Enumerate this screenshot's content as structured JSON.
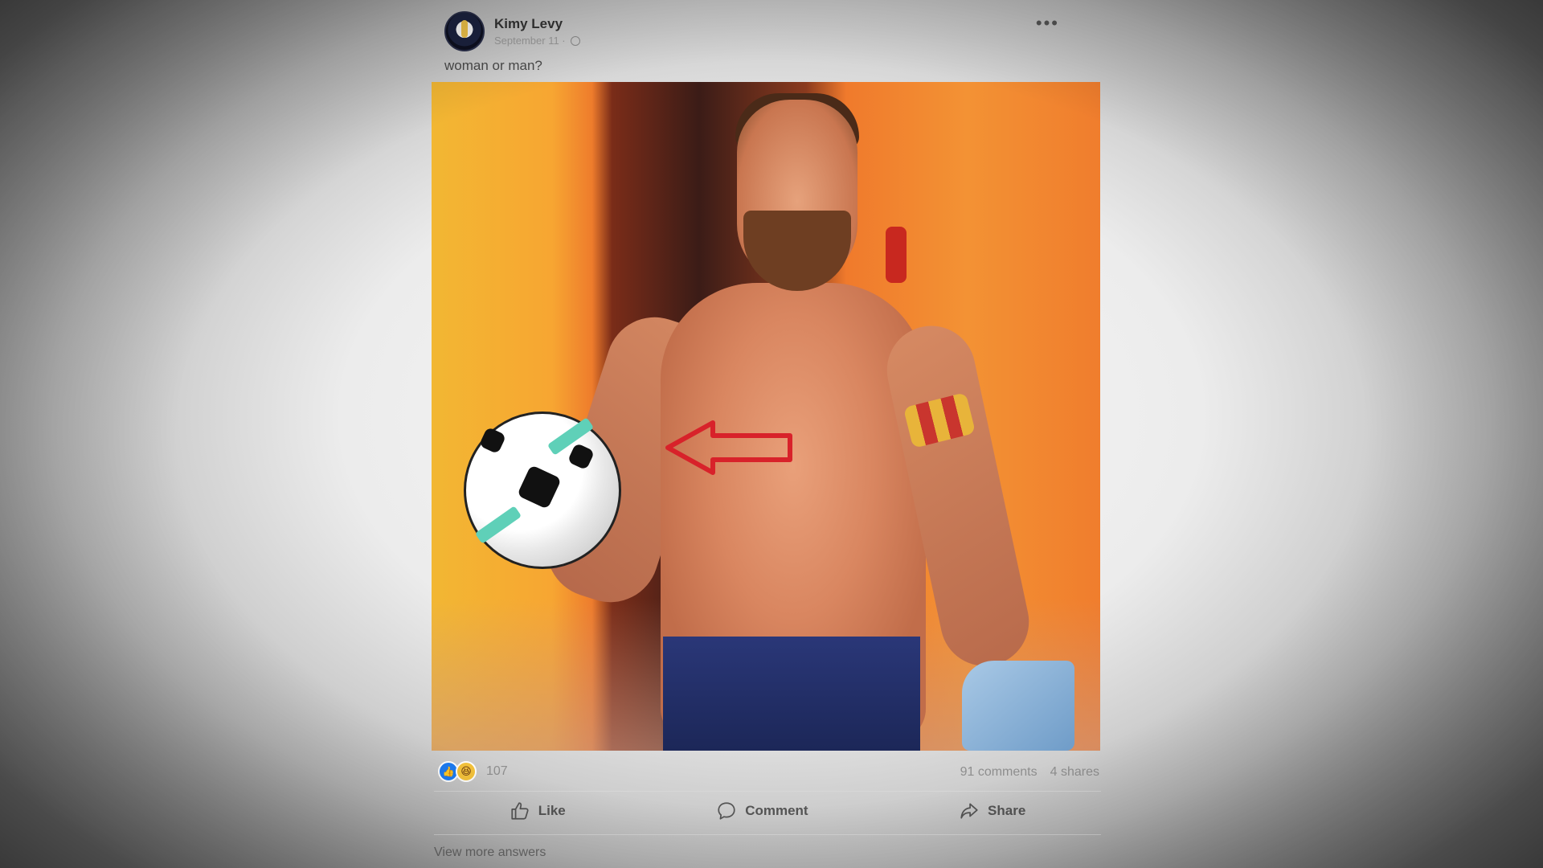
{
  "post": {
    "author": "Kimy Levy",
    "date": "September 11 ·",
    "text": "woman or man?",
    "more_label": "•••",
    "reactions": {
      "like_icon": "👍",
      "haha_icon": "😆",
      "count": "107"
    },
    "comments": "91 comments",
    "shares": "4 shares",
    "actions": {
      "like": "Like",
      "comment": "Comment",
      "share": "Share"
    },
    "view_more": "View more answers",
    "photo": {
      "description_icon": "photo-of-shirtless-footballer-holding-ball",
      "annotation": "red-arrow-pointing-left"
    }
  },
  "colors": {
    "accent_like": "#1d7cf2",
    "arrow": "#d8222a"
  }
}
